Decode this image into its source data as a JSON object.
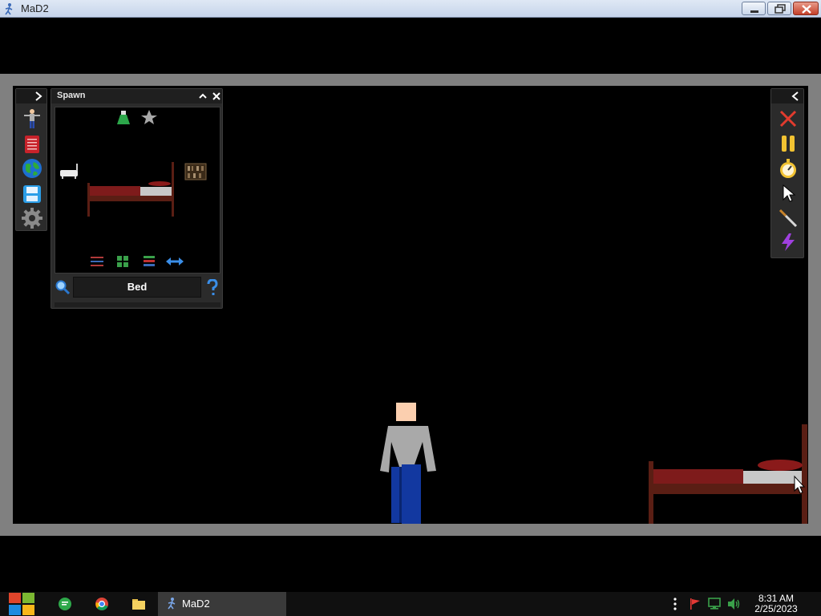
{
  "window": {
    "title": "MaD2"
  },
  "spawn_panel": {
    "title": "Spawn",
    "search_value": "Bed"
  },
  "left_toolbar": {
    "icons": [
      "ragdoll-icon",
      "book-icon",
      "globe-icon",
      "save-icon",
      "gear-icon"
    ]
  },
  "right_toolbar": {
    "icons": [
      "close-x-icon",
      "pause-icon",
      "stopwatch-icon",
      "pointer-icon",
      "knife-icon",
      "lightning-icon"
    ]
  },
  "taskbar": {
    "task_label": "MaD2",
    "time": "8:31 AM",
    "date": "2/25/2023"
  },
  "colors": {
    "frame": "#808080",
    "stage": "#000000",
    "panel": "#2b2b2b",
    "bed_frame": "#5a1e14",
    "bed_sheet": "#7e1b1b"
  }
}
